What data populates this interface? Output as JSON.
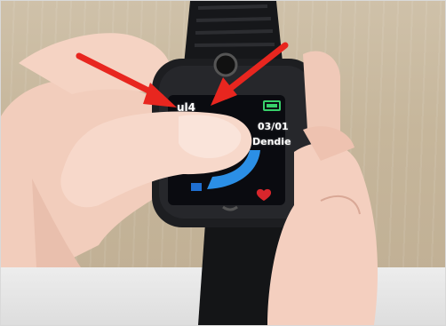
{
  "watch_screen": {
    "signal_text": "ul4",
    "date": "03/01",
    "weekday": "Dendie"
  },
  "colors": {
    "arrow": "#e8261f",
    "watch_body": "#1d1e21",
    "screen": "#0a0b10",
    "battery": "#38d16b",
    "accent_blue": "#2b8fe6",
    "heart": "#d8262c"
  }
}
